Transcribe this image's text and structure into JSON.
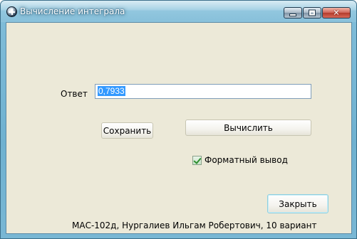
{
  "window": {
    "title": "Вычисление интеграла",
    "controls": {
      "minimize": "_",
      "maximize": "□",
      "close": "✕"
    }
  },
  "form": {
    "answer_label": "Ответ",
    "answer_value": "0,7933",
    "save_label": "Сохранить",
    "calculate_label": "Вычислить",
    "formatted_output": {
      "label": "Форматный вывод",
      "checked": true
    },
    "close_label": "Закрыть",
    "footer": "МАС-102д, Нургалиев Ильгам Робертович, 10 вариант"
  }
}
